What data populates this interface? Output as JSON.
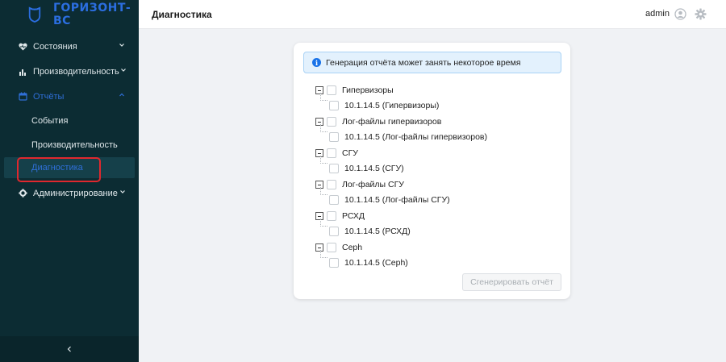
{
  "brand": {
    "name": "ГОРИЗОНТ-ВС"
  },
  "sidebar": {
    "items": [
      {
        "label": "Состояния",
        "icon": "heart-icon"
      },
      {
        "label": "Производительность",
        "icon": "bar-chart-icon"
      },
      {
        "label": "Отчёты",
        "icon": "calendar-icon",
        "open": true,
        "children": [
          {
            "label": "События"
          },
          {
            "label": "Производительность"
          },
          {
            "label": "Диагностика",
            "active": true
          }
        ]
      },
      {
        "label": "Администрирование",
        "icon": "gear-icon"
      }
    ],
    "collapse_label": "<"
  },
  "header": {
    "title": "Диагностика",
    "user": "admin"
  },
  "main": {
    "info": "Генерация отчёта может занять некоторое время",
    "tree": [
      {
        "label": "Гипервизоры",
        "child": "10.1.14.5 (Гипервизоры)"
      },
      {
        "label": "Лог-файлы гипервизоров",
        "child": "10.1.14.5 (Лог-файлы гипервизоров)"
      },
      {
        "label": "СГУ",
        "child": "10.1.14.5 (СГУ)"
      },
      {
        "label": "Лог-файлы СГУ",
        "child": "10.1.14.5 (Лог-файлы СГУ)"
      },
      {
        "label": "РСХД",
        "child": "10.1.14.5 (РСХД)"
      },
      {
        "label": "Ceph",
        "child": "10.1.14.5 (Ceph)"
      }
    ],
    "generate_button": "Сгенерировать отчёт"
  },
  "colors": {
    "sidebar_bg": "#0c2c33",
    "accent": "#2f6fd8",
    "highlight": "#e0282e",
    "info_bg": "#e3f1fd"
  }
}
